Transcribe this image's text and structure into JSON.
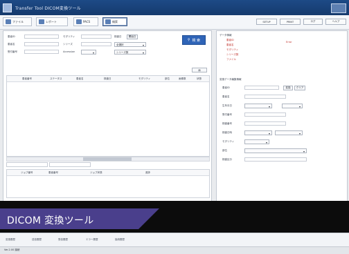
{
  "window": {
    "title": "Transfer Tool  DICOM変換ツール"
  },
  "toolbar": {
    "buttons": [
      {
        "label": "ファイル",
        "icon": "folder-icon"
      },
      {
        "label": "レポート",
        "icon": "report-icon"
      },
      {
        "label": "PACS",
        "icon": "pacs-icon"
      },
      {
        "label": "検索",
        "icon": "search-icon"
      }
    ],
    "right_buttons": [
      "SETUP",
      "PRINT",
      "ログ",
      "ヘルプ"
    ]
  },
  "search": {
    "row1": {
      "l1": "患者ID",
      "l2": "モダリティ",
      "l3": "検査日",
      "opt": "開始日"
    },
    "row2": {
      "l1": "患者名",
      "l2": "シリーズ",
      "dd": "全選択"
    },
    "row3": {
      "l1": "受付番号",
      "l2": "Accession",
      "dd": "シリーズ数"
    },
    "button": "検 索"
  },
  "table": {
    "columns": [
      "患者番号",
      "ステータス",
      "患者名",
      "検査日",
      "モダリティ",
      "部位",
      "画像数",
      "状態"
    ],
    "subheaders": [
      "ジョブ番号",
      "患者番号",
      "ジョブ状態",
      "進捗"
    ]
  },
  "detail": {
    "title": "データ情報",
    "status_rows": [
      "患者ID",
      "患者名",
      "モダリティ",
      "シリーズ数",
      "ファイル"
    ],
    "status_value": "Error",
    "section": "変換データ編集情報",
    "fields": [
      "患者ID",
      "患者名",
      "生年月日",
      "受付番号",
      "検査番号",
      "検査日時",
      "モダリティ",
      "部位",
      "検査区分"
    ],
    "btn1": "変換",
    "btn2": "クリア"
  },
  "banner": {
    "text": "DICOM 変換ツール",
    "color": "#4a3f8c"
  },
  "tabs": [
    "変換履歴",
    "送信履歴",
    "受信履歴",
    "エラー履歴",
    "接続履歴"
  ],
  "status": "Ver.2.00  接続"
}
